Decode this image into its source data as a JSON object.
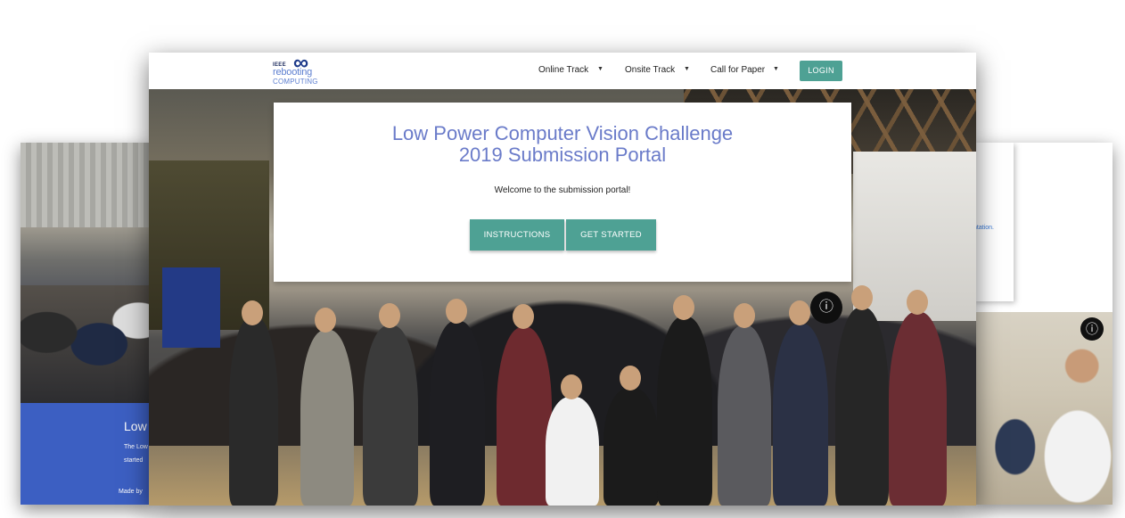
{
  "navbar": {
    "logo": {
      "ieee": "IEEE",
      "line1": "rebooting",
      "line2": "COMPUTING"
    },
    "links": [
      {
        "label": "Online Track"
      },
      {
        "label": "Onsite Track"
      },
      {
        "label": "Call for Paper"
      }
    ],
    "login_label": "LOGIN"
  },
  "hero": {
    "title_line1": "Low Power Computer Vision Challenge",
    "title_line2": "2019 Submission Portal",
    "welcome": "Welcome to the submission portal!",
    "instructions_label": "INSTRUCTIONS",
    "get_started_label": "GET STARTED",
    "info_glyph": "ⓘ"
  },
  "left_card": {
    "footer_title": "Low P",
    "footer_text_1": "The Low",
    "footer_text_2": "started",
    "made_by": "Made by"
  },
  "right_card": {
    "link_fragment": "ntation.",
    "info_glyph": "ⓘ"
  },
  "colors": {
    "accent_teal": "#4ea194",
    "title_blue": "#6a7bc9",
    "footer_blue": "#3c5fc2"
  },
  "icons": [
    "caret-down-icon",
    "info-icon",
    "ieee-logo"
  ]
}
